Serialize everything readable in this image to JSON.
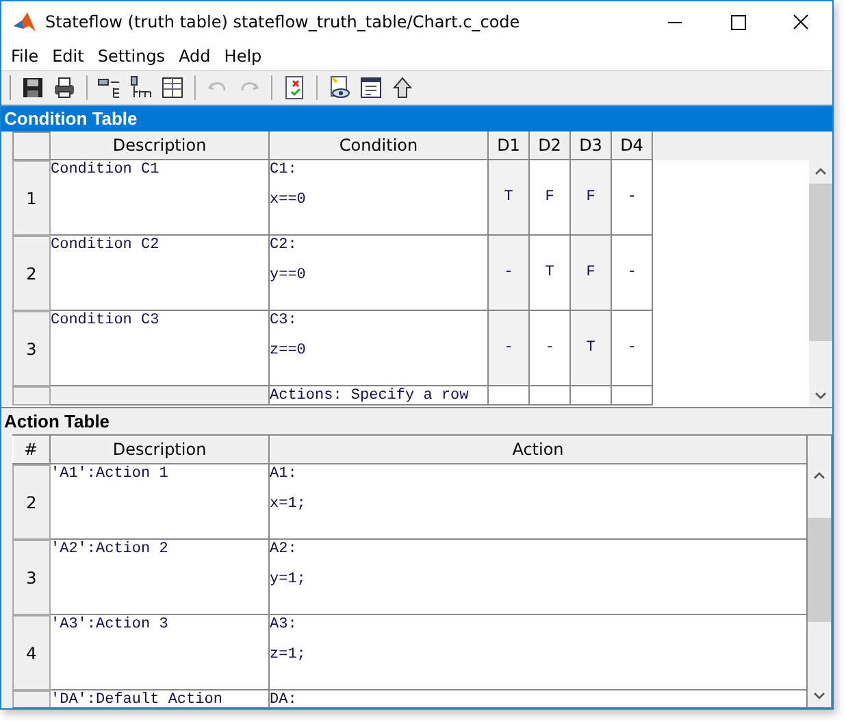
{
  "window": {
    "title": "Stateflow (truth table) stateflow_truth_table/Chart.c_code"
  },
  "menu": [
    "File",
    "Edit",
    "Settings",
    "Add",
    "Help"
  ],
  "toolbar": [
    {
      "disabled": false
    },
    {
      "disabled": false
    },
    {
      "disabled": false
    },
    {
      "disabled": false
    },
    {
      "disabled": false
    },
    {
      "disabled": true
    },
    {
      "disabled": true
    },
    {
      "disabled": false
    },
    {
      "disabled": false
    },
    {
      "disabled": false
    },
    {
      "disabled": false
    }
  ],
  "condition_table": {
    "title": "Condition Table",
    "columns": [
      "Description",
      "Condition",
      "D1",
      "D2",
      "D3",
      "D4"
    ],
    "rows": [
      {
        "number": "1",
        "description": "Condition C1",
        "condition": [
          "C1:",
          "x==0"
        ],
        "decisions": [
          "T",
          "F",
          "F",
          "-"
        ]
      },
      {
        "number": "2",
        "description": "Condition C2",
        "condition": [
          "C2:",
          "y==0"
        ],
        "decisions": [
          "-",
          "T",
          "F",
          "-"
        ]
      },
      {
        "number": "3",
        "description": "Condition C3",
        "condition": [
          "C3:",
          "z==0"
        ],
        "decisions": [
          "-",
          "-",
          "T",
          "-"
        ]
      },
      {
        "condition": [
          "Actions: Specify a row"
        ]
      }
    ]
  },
  "action_table": {
    "title": "Action Table",
    "columns": [
      "#",
      "Description",
      "Action"
    ],
    "rows": [
      {
        "number": "2",
        "description": "'A1':Action 1",
        "action": [
          "A1:",
          "x=1;"
        ]
      },
      {
        "number": "3",
        "description": "'A2':Action 2",
        "action": [
          "A2:",
          "y=1;"
        ]
      },
      {
        "number": "4",
        "description": "'A3':Action 3",
        "action": [
          "A3:",
          "z=1;"
        ]
      },
      {
        "description": "'DA':Default Action",
        "action": [
          "DA:"
        ]
      }
    ]
  }
}
